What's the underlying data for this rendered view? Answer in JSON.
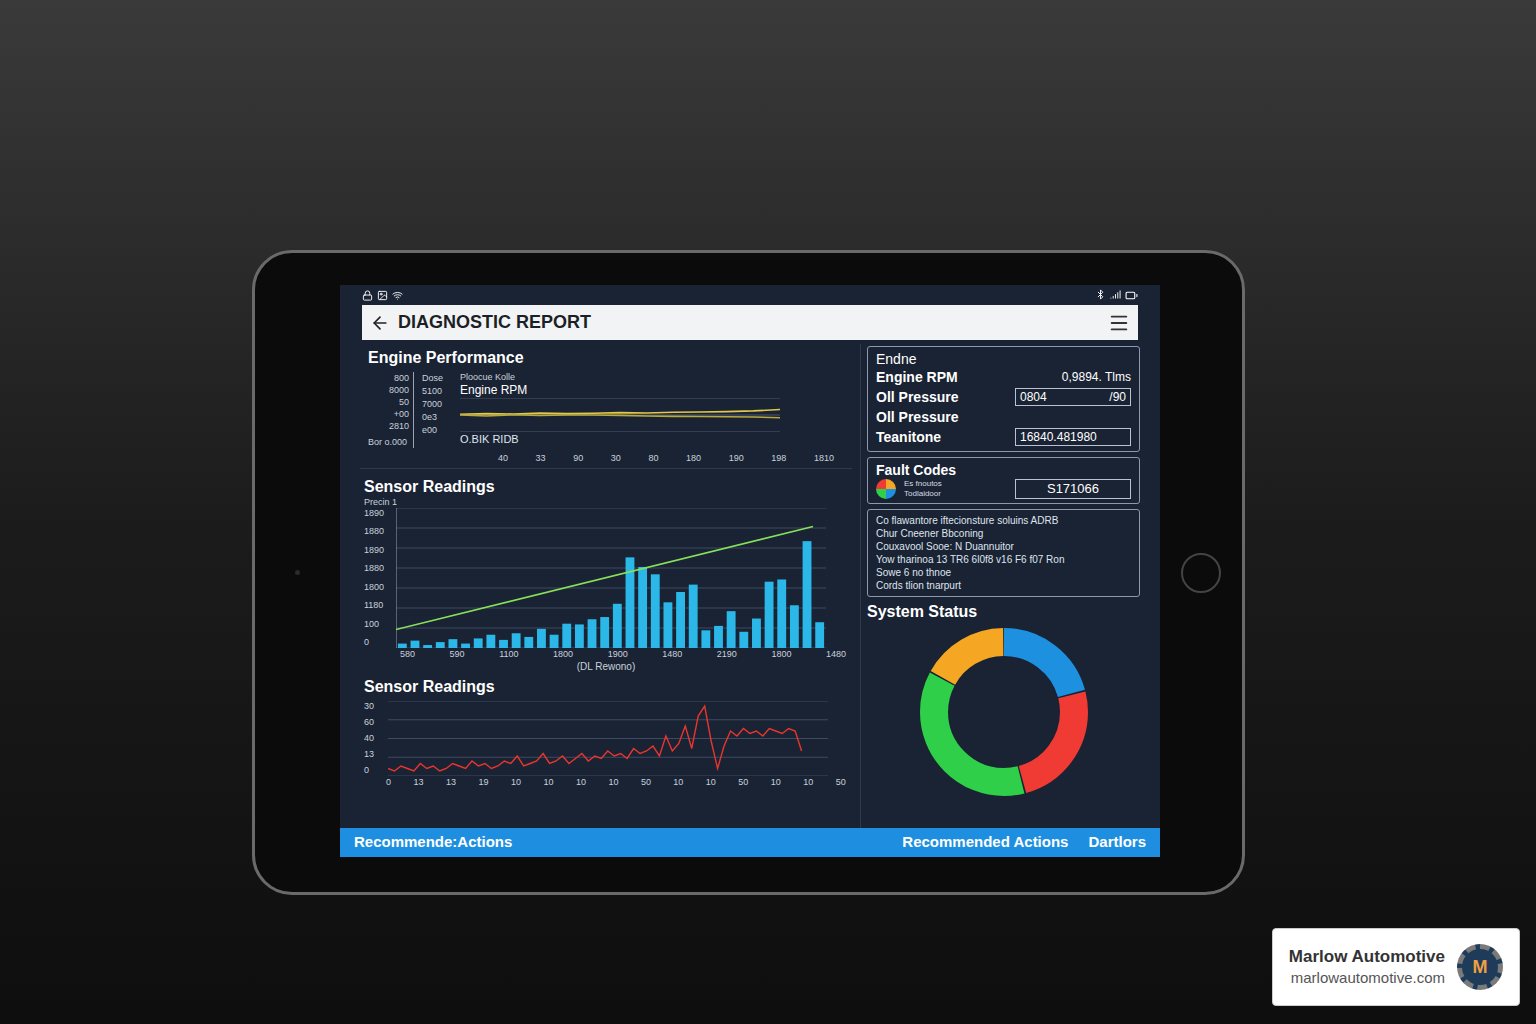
{
  "header": {
    "title": "DIAGNOSTIC REPORT"
  },
  "engine_performance": {
    "title": "Engine Performance",
    "y_ticks": [
      "800",
      "8000",
      "50",
      "+00",
      "2810"
    ],
    "footer": "Bor o.000",
    "y_ticks_2": [
      "Dose",
      "5100",
      "7000",
      "0e3",
      "e00"
    ],
    "legend_top": "Ploocue Kolle",
    "series_label": "Engine RPM",
    "legend_bottom": "O.BIK RIDB",
    "x_ticks": [
      "40",
      "33",
      "90",
      "30",
      "80",
      "180",
      "190",
      "198",
      "1810"
    ],
    "series": [
      {
        "values": [
          520,
          540,
          530,
          560,
          545,
          550,
          570,
          560,
          580,
          590,
          600,
          620,
          660
        ],
        "color": "#e3c84a"
      },
      {
        "values": [
          500,
          470,
          510,
          490,
          505,
          500,
          490,
          470,
          460,
          455,
          450,
          440,
          420
        ],
        "color": "#b8a93e"
      }
    ]
  },
  "sensor_bars": {
    "title": "Sensor Readings",
    "y_title": "Precin 1",
    "y_ticks": [
      "1890",
      "1880",
      "1890",
      "1880",
      "1800",
      "1180",
      "100",
      "0"
    ],
    "x_ticks": [
      "580",
      "590",
      "1100",
      "1800",
      "1900",
      "1480",
      "2190",
      "1800",
      "1480"
    ],
    "x_title": "(DL Rewono)",
    "bars": [
      60,
      100,
      40,
      80,
      120,
      60,
      130,
      180,
      110,
      200,
      150,
      260,
      180,
      330,
      320,
      390,
      420,
      600,
      1230,
      1100,
      1000,
      620,
      760,
      860,
      240,
      300,
      500,
      220,
      400,
      900,
      930,
      580,
      1450,
      350
    ],
    "trend": [
      250,
      1650
    ]
  },
  "sensor_line": {
    "title": "Sensor Readings",
    "y_ticks": [
      "30",
      "60",
      "40",
      "13",
      "0"
    ],
    "x_ticks": [
      "0",
      "13",
      "13",
      "19",
      "10",
      "10",
      "10",
      "10",
      "50",
      "10",
      "10",
      "50",
      "10",
      "10",
      "50"
    ],
    "values": [
      3,
      2,
      4,
      3,
      2,
      5,
      3,
      4,
      2,
      3,
      5,
      4,
      3,
      6,
      4,
      5,
      3,
      4,
      6,
      5,
      8,
      4,
      5,
      6,
      9,
      5,
      6,
      8,
      5,
      7,
      9,
      6,
      8,
      7,
      10,
      8,
      9,
      7,
      11,
      9,
      10,
      12,
      8,
      16,
      10,
      13,
      20,
      11,
      24,
      28,
      14,
      3,
      12,
      18,
      16,
      19,
      17,
      18,
      16,
      19,
      18,
      17,
      19,
      18,
      10
    ]
  },
  "metrics": {
    "heading": "Endne",
    "rows": [
      {
        "label": "Engine RPM",
        "value": "0,9894. Tlms",
        "kind": "plain"
      },
      {
        "label": "Oll Pressure",
        "value": "0804",
        "unit": "/90",
        "kind": "field"
      },
      {
        "label": "Oll Pressure",
        "kind": "label"
      },
      {
        "label": "Teanitone",
        "value": "16840.481980",
        "kind": "field"
      }
    ]
  },
  "fault_codes": {
    "title": "Fault Codes",
    "caption": [
      "Es fnoutos",
      "Todlaidoor"
    ],
    "code": "S171066"
  },
  "notes": [
    "Co flawantore iftecionsture soluins ADRB",
    "Chur Cneener Bbconing",
    "Couxavool Sooe: N Duannuitor",
    "Yow tharinoa 13 TR6 6l0f8 v16 F6 f07 Ron",
    "Sowe 6 no thnoe",
    "Cords tlion tnarpurt"
  ],
  "system_status": {
    "title": "System Status",
    "segments": [
      {
        "share": 0.21,
        "color": "#1e90e0"
      },
      {
        "share": 0.25,
        "color": "#ef3b34"
      },
      {
        "share": 0.37,
        "color": "#2fcf4a"
      },
      {
        "share": 0.17,
        "color": "#f5a623"
      }
    ]
  },
  "action_bar": {
    "left": "Recommende:Actions",
    "right": [
      "Recommended Actions",
      "Dartlors"
    ]
  },
  "badge": {
    "name": "Marlow Automotive",
    "url": "marlowautomotive.com",
    "logo_letter": "M"
  }
}
